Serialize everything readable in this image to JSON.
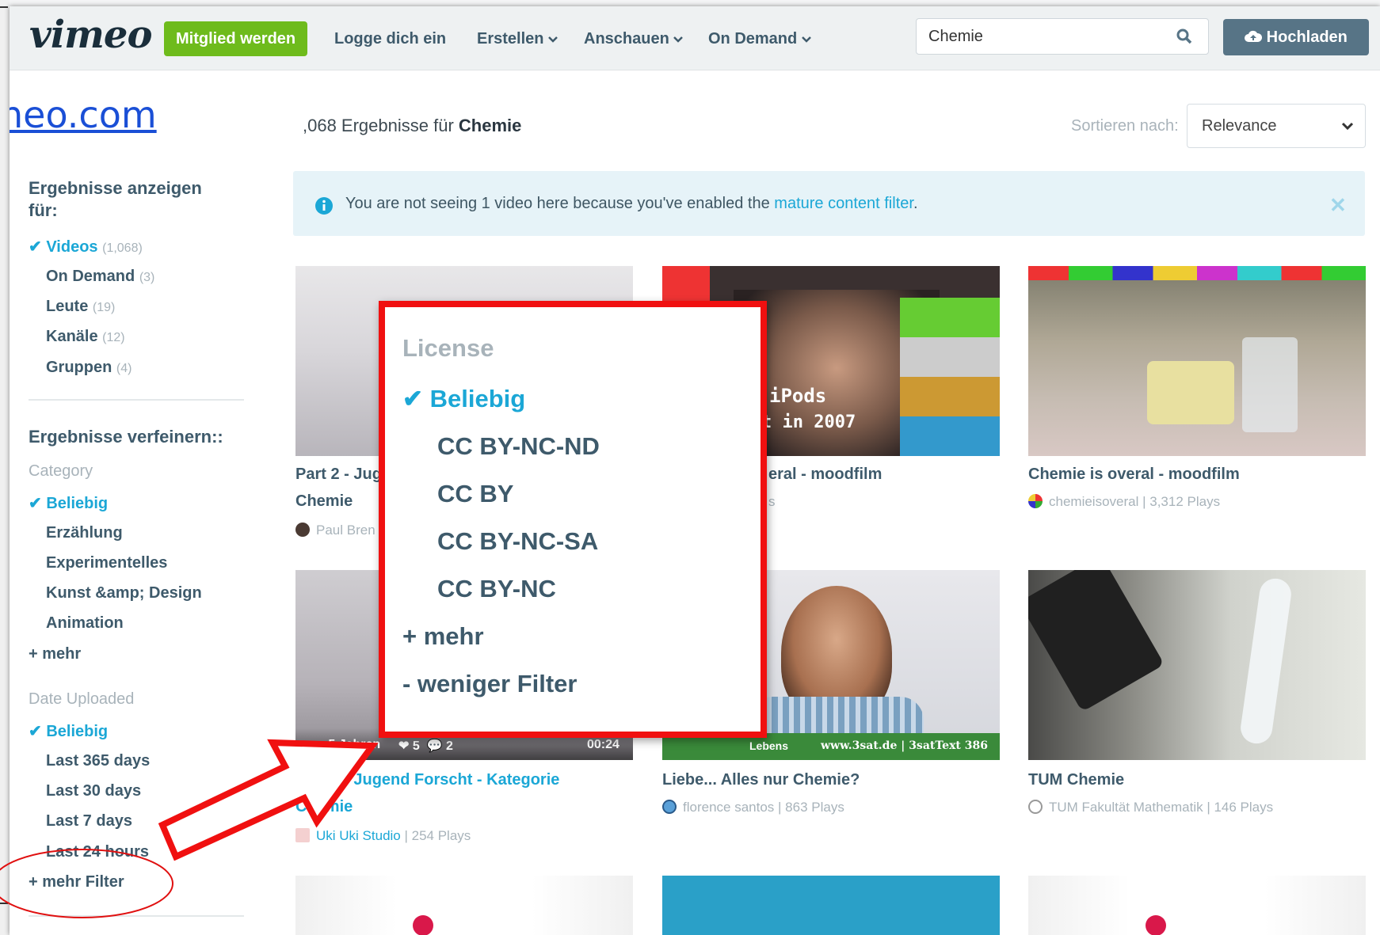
{
  "header": {
    "logo": "vimeo",
    "join_label": "Mitglied werden",
    "nav": [
      {
        "label": "Logge dich ein",
        "dropdown": false
      },
      {
        "label": "Erstellen",
        "dropdown": true
      },
      {
        "label": "Anschauen",
        "dropdown": true
      },
      {
        "label": "On Demand",
        "dropdown": true
      }
    ],
    "search_value": "Chemie",
    "upload_label": "Hochladen"
  },
  "url_fragment": "neo.com",
  "results": {
    "count_text": ",068 Ergebnisse für ",
    "query": "Chemie",
    "sort_label": "Sortieren nach:",
    "sort_value": "Relevance"
  },
  "notice": {
    "text": "You are not seeing 1 video here because you've enabled the ",
    "link": "mature content filter",
    "suffix": "."
  },
  "sidebar": {
    "show_title": "Ergebnisse anzeigen für:",
    "types": [
      {
        "label": "Videos",
        "count": "(1,068)",
        "active": true
      },
      {
        "label": "On Demand",
        "count": "(3)",
        "active": false
      },
      {
        "label": "Leute",
        "count": "(19)",
        "active": false
      },
      {
        "label": "Kanäle",
        "count": "(12)",
        "active": false
      },
      {
        "label": "Gruppen",
        "count": "(4)",
        "active": false
      }
    ],
    "refine_title": "Ergebnisse verfeinern::",
    "category_label": "Category",
    "categories": [
      "Beliebig",
      "Erzählung",
      "Experimentelles",
      "Kunst &amp; Design",
      "Animation"
    ],
    "category_more": "+ mehr",
    "date_label": "Date Uploaded",
    "dates": [
      "Beliebig",
      "Last 365 days",
      "Last 30 days",
      "Last 7 days",
      "Last 24 hours"
    ],
    "more_filter": "+ mehr Filter"
  },
  "videos": [
    {
      "title1": "Part 2 - Jug",
      "title2": "Chemie",
      "meta": "Paul Bren"
    },
    {
      "title1": "eral - moodfilm",
      "meta": "s",
      "overlay1": "iPods",
      "overlay2": "t in 2007"
    },
    {
      "title1": "Chemie is overal - moodfilm",
      "user": "chemieisoveral",
      "meta": " | 3,312 Plays"
    },
    {
      "title1": "Part 2 - Jugend Forscht - Kategorie",
      "title2": "Chemie",
      "user": "Uki Uki Studio",
      "meta": " | 254 Plays",
      "overlay_left": "vor 5 Jahren",
      "likes": "5",
      "comments": "2",
      "duration": "00:24"
    },
    {
      "title1": "Liebe... Alles nur Chemie?",
      "user": "florence santos",
      "meta": " | 863 Plays",
      "overlay_text": "www.3sat.de | 3satText 386",
      "overlay_small": "Lebens"
    },
    {
      "title1": "TUM Chemie",
      "user": "TUM Fakultät Mathematik",
      "meta": " | 146 Plays"
    }
  ],
  "popup": {
    "title": "License",
    "items": [
      "Beliebig",
      "CC BY-NC-ND",
      "CC BY",
      "CC BY-NC-SA",
      "CC BY-NC"
    ],
    "more": "+ mehr",
    "less": "- weniger Filter"
  },
  "colors": {
    "accent": "#1ba7d6",
    "join_green": "#6ebb1c",
    "annotation_red": "#f01010"
  }
}
